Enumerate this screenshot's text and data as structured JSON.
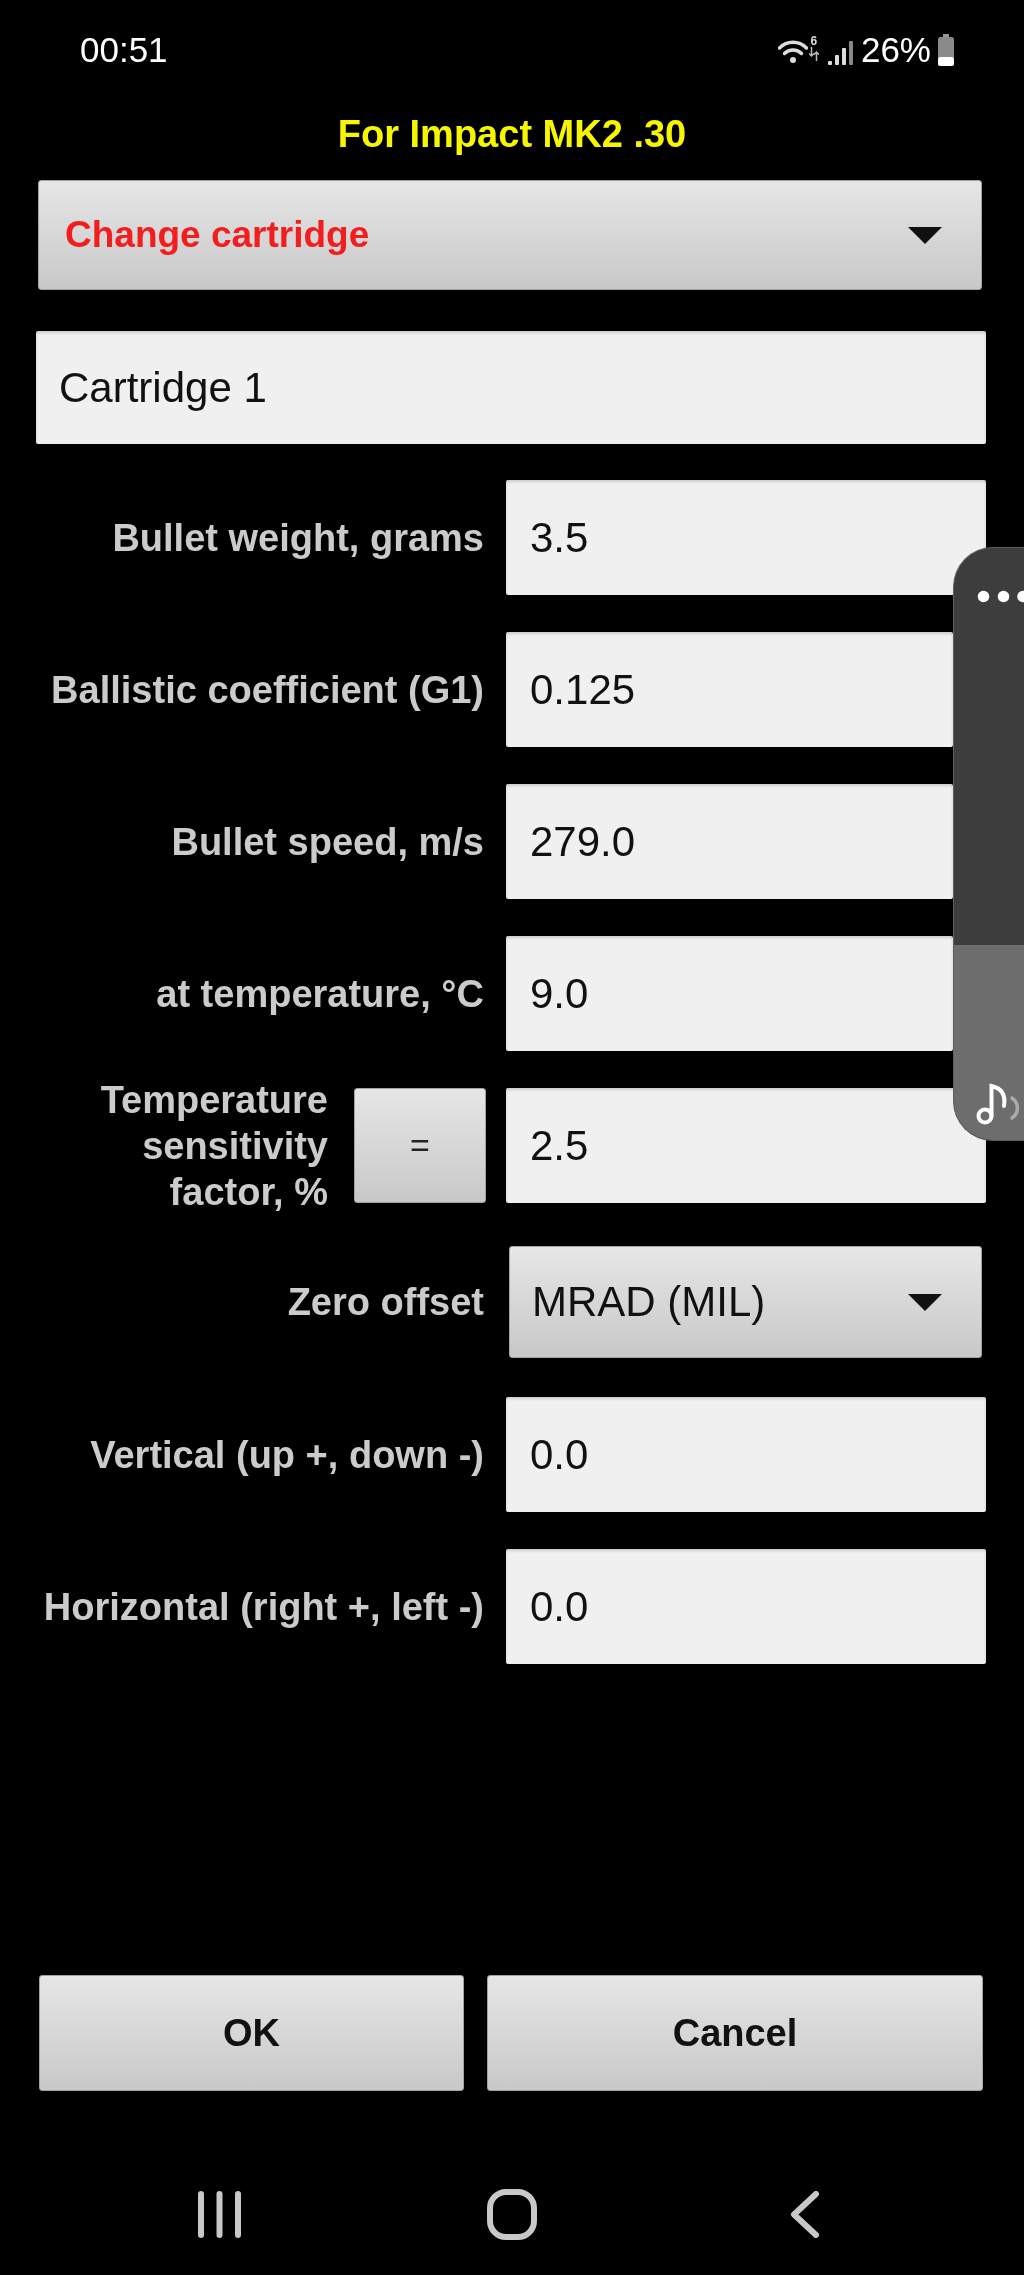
{
  "status_bar": {
    "time": "00:51",
    "wifi_label": "6",
    "battery": "26%"
  },
  "title": "For Impact MK2 .30",
  "cartridge_dropdown": {
    "label": "Change cartridge"
  },
  "cartridge_name": {
    "value": "Cartridge 1"
  },
  "fields": [
    {
      "kind": "input",
      "label": "Bullet weight, grams",
      "value": "3.5"
    },
    {
      "kind": "input",
      "label": "Ballistic coefficient (G1)",
      "value": "0.125"
    },
    {
      "kind": "input",
      "label": "Bullet speed, m/s",
      "value": "279.0"
    },
    {
      "kind": "input",
      "label": "at temperature, °C",
      "value": "9.0"
    },
    {
      "kind": "input_with_button",
      "label": "Temperature sensitivity factor, %",
      "button": "=",
      "value": "2.5"
    },
    {
      "kind": "dropdown",
      "label": "Zero offset",
      "value": "MRAD (MIL)"
    },
    {
      "kind": "input",
      "label": "Vertical (up +, down -)",
      "value": "0.0"
    },
    {
      "kind": "input",
      "label": "Horizontal (right +, left -)",
      "value": "0.0"
    }
  ],
  "buttons": [
    "OK",
    "Cancel"
  ],
  "volume_panel": {
    "level": 0.33
  }
}
